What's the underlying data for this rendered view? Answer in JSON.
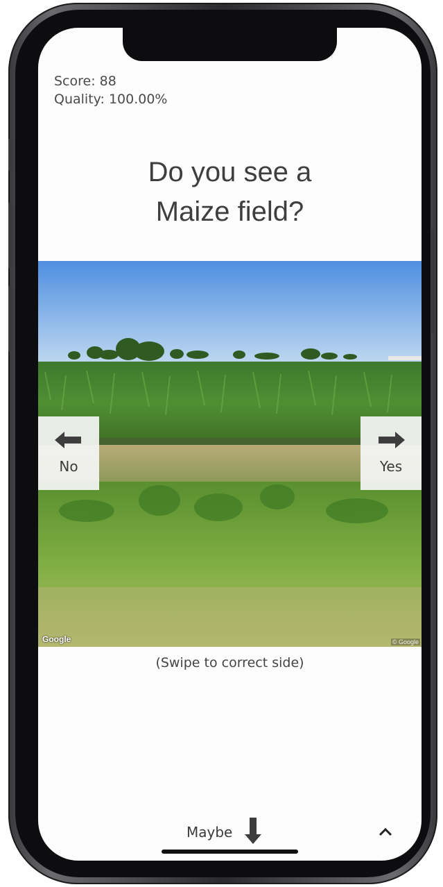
{
  "stats": {
    "score": "Score: 88",
    "quality": "Quality: 100.00%"
  },
  "question": {
    "line1": "Do you see a",
    "line2": "Maize field?"
  },
  "image": {
    "watermark_left": "Google",
    "watermark_right": "© Google"
  },
  "actions": {
    "no_label": "No",
    "yes_label": "Yes",
    "maybe_label": "Maybe"
  },
  "hint": "(Swipe to correct side)",
  "icons": {
    "no": "arrow-left-icon",
    "yes": "arrow-right-icon",
    "maybe": "arrow-down-icon",
    "expand": "chevron-up-icon"
  }
}
